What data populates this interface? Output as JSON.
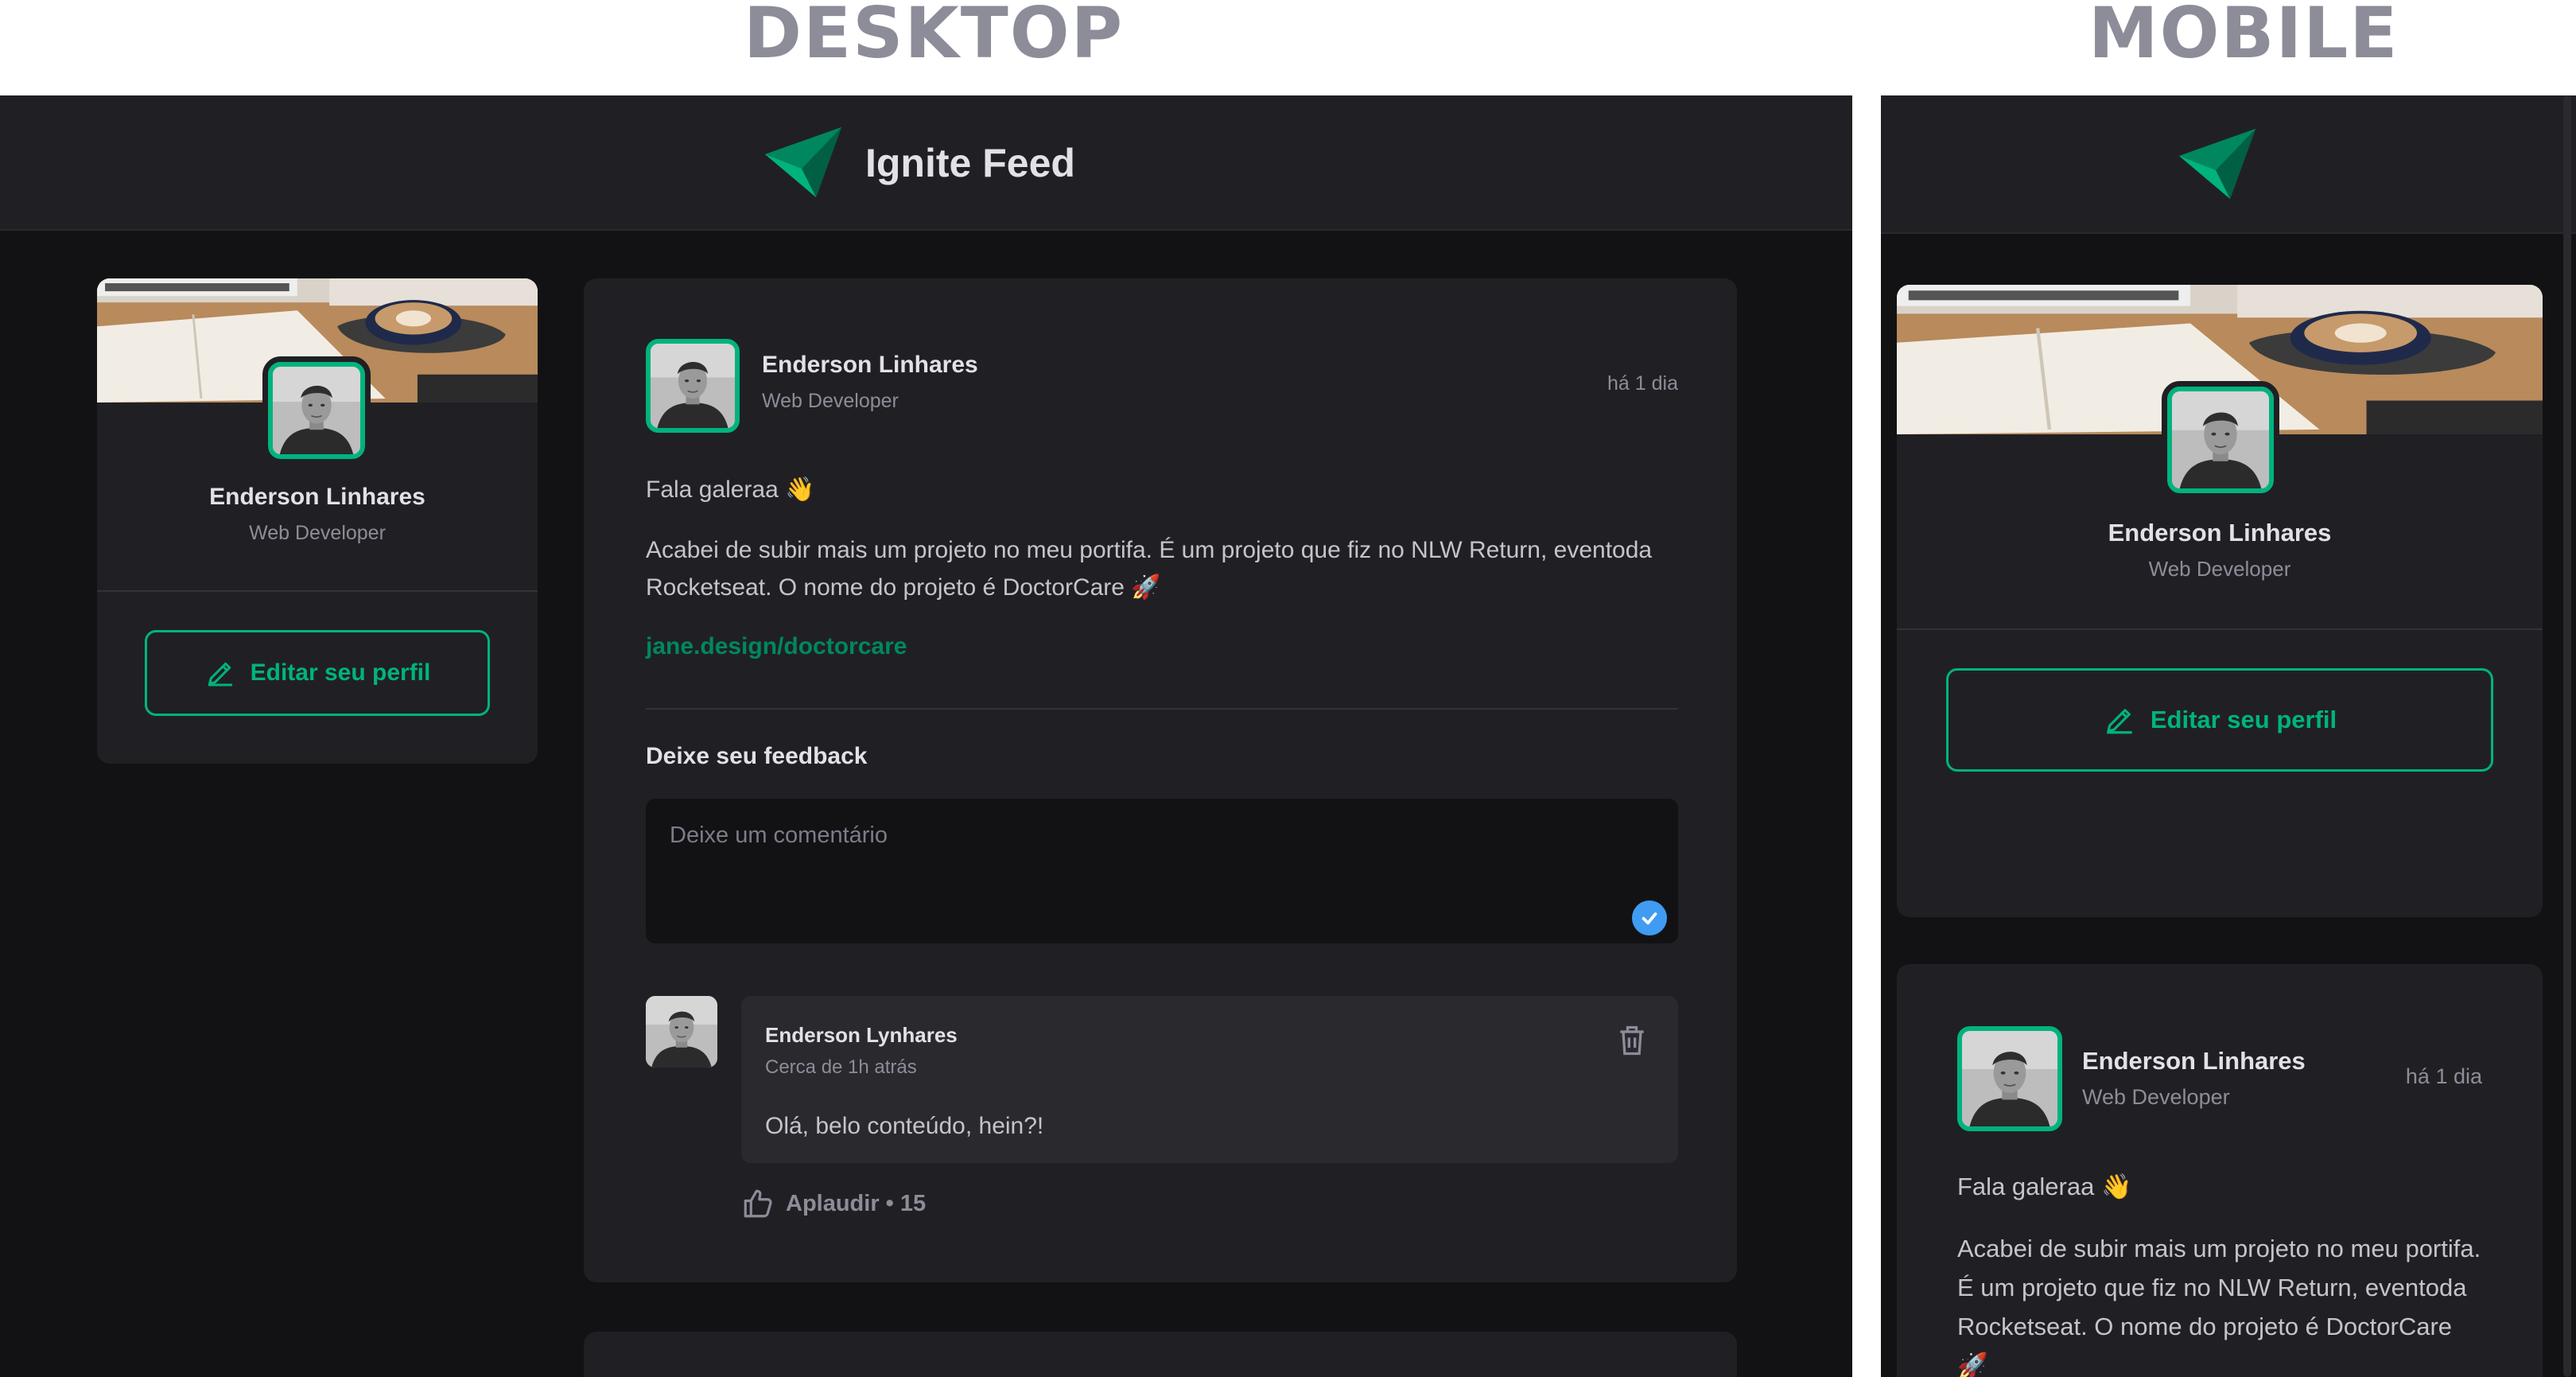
{
  "labels": {
    "desktop": "DESKTOP",
    "mobile": "MOBILE"
  },
  "header": {
    "brand": "Ignite Feed",
    "logo_icon": "ignite-logo-icon"
  },
  "profile": {
    "name": "Enderson Linhares",
    "role": "Web Developer",
    "edit_label": "Editar seu perfil"
  },
  "post": {
    "author": "Enderson Linhares",
    "role": "Web Developer",
    "time": "há 1 dia",
    "greeting": "Fala galeraa 👋",
    "text": "Acabei de subir mais um projeto no meu portifa. É um projeto que fiz no NLW Return, eventoda Rocketseat. O nome do projeto é DoctorCare 🚀",
    "link": "jane.design/doctorcare",
    "feedback_title": "Deixe seu feedback",
    "comment_placeholder": "Deixe um comentário"
  },
  "comment": {
    "author": "Enderson Lynhares",
    "time": "Cerca de 1h atrás",
    "text": "Olá, belo conteúdo, hein?!",
    "applaud_label": "Aplaudir",
    "applaud_count": "15",
    "applaud_text": "Aplaudir • 15"
  },
  "colors": {
    "accent": "#00b37e",
    "link": "#00875f",
    "background": "#121214",
    "surface": "#202024",
    "submit": "#3f9cf2"
  }
}
